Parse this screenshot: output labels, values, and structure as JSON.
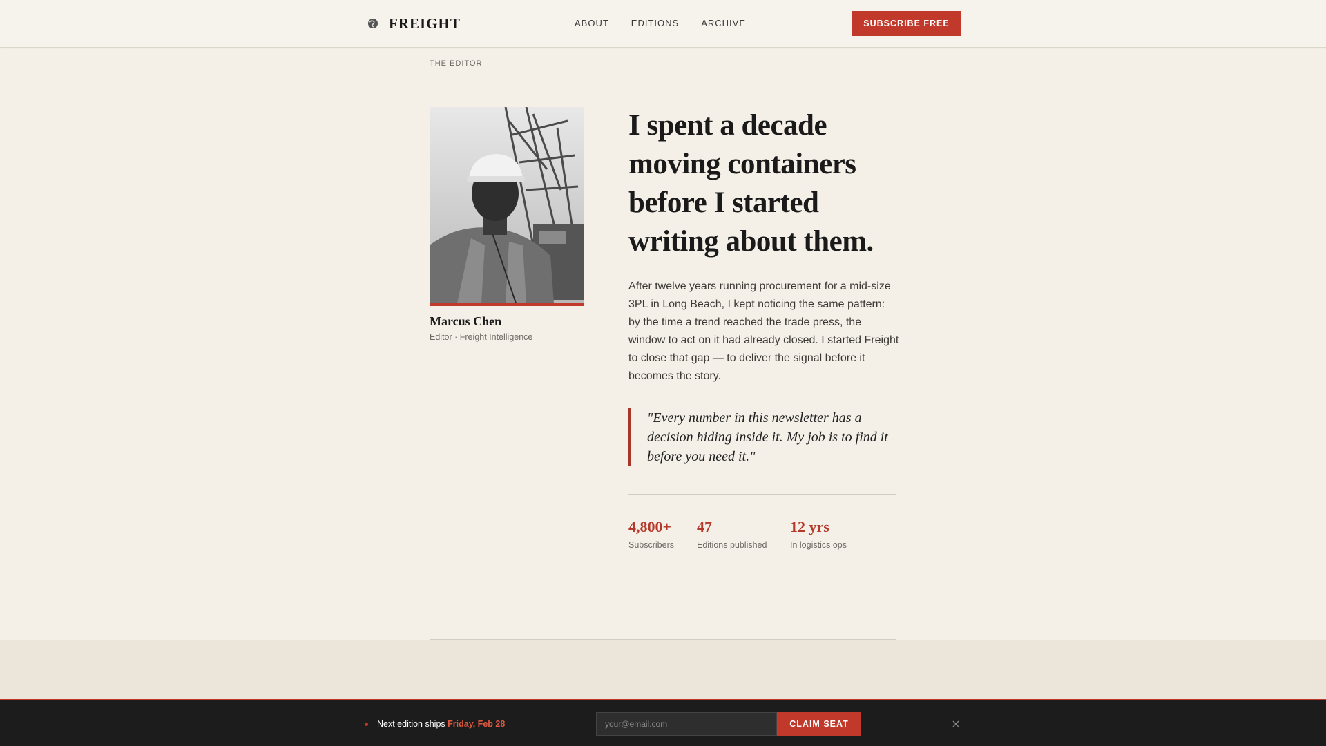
{
  "header": {
    "brand": "FREIGHT",
    "nav": [
      "ABOUT",
      "EDITIONS",
      "ARCHIVE"
    ],
    "subscribe_label": "SUBSCRIBE FREE"
  },
  "section_label": "THE EDITOR",
  "editor": {
    "name": "Marcus Chen",
    "role": "Editor · Freight Intelligence"
  },
  "headline_lines": [
    "I spent a decade",
    "moving containers",
    "before I started",
    "writing about them."
  ],
  "bio": "After twelve years running procurement for a mid-size 3PL in Long Beach, I kept noticing the same pattern: by the time a trend reached the trade press, the window to act on it had already closed. I started Freight to close that gap — to deliver the signal before it becomes the story.",
  "quote": "\"Every number in this newsletter has a decision hiding inside it. My job is to find it before you need it.\"",
  "stats": [
    {
      "value": "4,800+",
      "label": "Subscribers"
    },
    {
      "value": "47",
      "label": "Editions published"
    },
    {
      "value": "12 yrs",
      "label": "In logistics ops"
    }
  ],
  "sticky_bar": {
    "prefix": "Next edition ships",
    "date": "Friday, Feb 28",
    "email_placeholder": "your@email.com",
    "cta": "CLAIM SEAT"
  },
  "colors": {
    "accent": "#c0392b",
    "background": "#f4f0e8",
    "bar": "#1c1c1c"
  }
}
